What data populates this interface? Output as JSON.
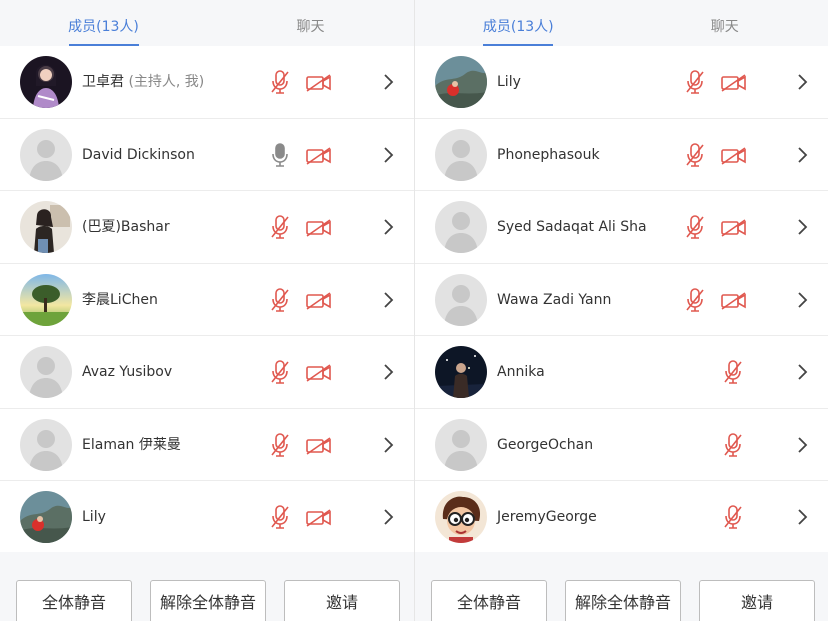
{
  "left": {
    "tabs": [
      {
        "label": "成员(13人)",
        "active": true
      },
      {
        "label": "聊天",
        "active": false
      }
    ],
    "members": [
      {
        "name": "卫卓君",
        "suffix": " (主持人, 我)",
        "avatar": "photo-girl",
        "mic": "muted",
        "cam": "off"
      },
      {
        "name": "David Dickinson",
        "suffix": "",
        "avatar": "default",
        "mic": "on",
        "cam": "off"
      },
      {
        "name": "(巴夏)Bashar",
        "suffix": "",
        "avatar": "photo-woman",
        "mic": "muted",
        "cam": "off"
      },
      {
        "name": "李晨LiChen",
        "suffix": "",
        "avatar": "photo-tree",
        "mic": "muted",
        "cam": "off"
      },
      {
        "name": "Avaz Yusibov",
        "suffix": "",
        "avatar": "default",
        "mic": "muted",
        "cam": "off"
      },
      {
        "name": "Elaman 伊莱曼",
        "suffix": "",
        "avatar": "default",
        "mic": "muted",
        "cam": "off"
      },
      {
        "name": "Lily",
        "suffix": "",
        "avatar": "photo-rock",
        "mic": "muted",
        "cam": "off"
      }
    ],
    "buttons": {
      "mute_all": "全体静音",
      "unmute_all": "解除全体静音",
      "invite": "邀请"
    }
  },
  "right": {
    "tabs": [
      {
        "label": "成员(13人)",
        "active": true
      },
      {
        "label": "聊天",
        "active": false
      }
    ],
    "members": [
      {
        "name": "Lily",
        "suffix": "",
        "avatar": "photo-rock",
        "mic": "muted",
        "cam": "off"
      },
      {
        "name": "Phonephasouk",
        "suffix": "",
        "avatar": "default",
        "mic": "muted",
        "cam": "off"
      },
      {
        "name": "Syed Sadaqat Ali Sha",
        "suffix": "",
        "avatar": "default",
        "mic": "muted",
        "cam": "off"
      },
      {
        "name": "Wawa Zadi Yann",
        "suffix": "",
        "avatar": "default",
        "mic": "muted",
        "cam": "off"
      },
      {
        "name": "Annika",
        "suffix": "",
        "avatar": "photo-night",
        "mic": "muted",
        "cam": "none"
      },
      {
        "name": "GeorgeOchan",
        "suffix": "",
        "avatar": "default",
        "mic": "muted",
        "cam": "none"
      },
      {
        "name": "JeremyGeorge",
        "suffix": "",
        "avatar": "photo-cartoon",
        "mic": "muted",
        "cam": "none"
      }
    ],
    "buttons": {
      "mute_all": "全体静音",
      "unmute_all": "解除全体静音",
      "invite": "邀请"
    }
  },
  "colors": {
    "accent": "#4a7fd8",
    "muted_red": "#e0584f",
    "icon_gray": "#8a8a8a"
  }
}
